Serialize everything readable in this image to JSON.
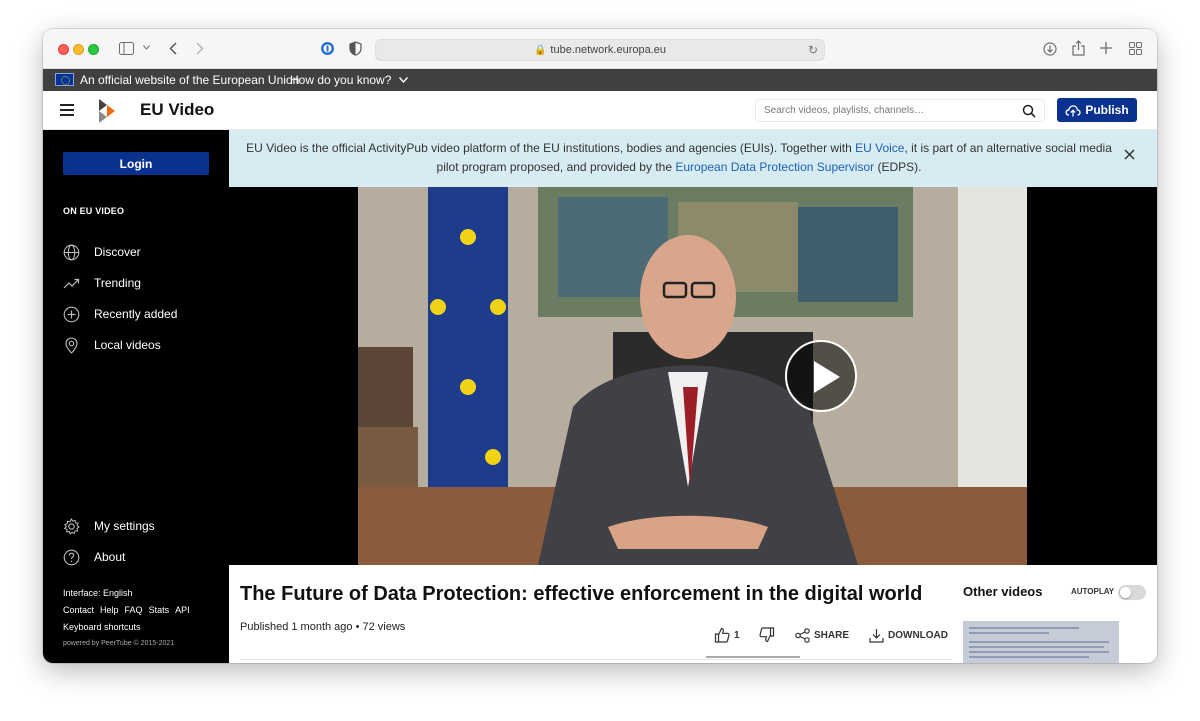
{
  "browser": {
    "url": "tube.network.europa.eu"
  },
  "eu_banner": {
    "text": "An official website of the European Union",
    "how_label": "How do you know?"
  },
  "header": {
    "site_title": "EU Video",
    "search_placeholder": "Search videos, playlists, channels…",
    "publish_label": "Publish"
  },
  "sidebar": {
    "login_label": "Login",
    "section_title": "ON EU VIDEO",
    "nav": [
      {
        "label": "Discover",
        "icon": "globe-icon"
      },
      {
        "label": "Trending",
        "icon": "trending-icon"
      },
      {
        "label": "Recently added",
        "icon": "plus-circle-icon"
      },
      {
        "label": "Local videos",
        "icon": "location-pin-icon"
      }
    ],
    "bottom_nav": [
      {
        "label": "My settings",
        "icon": "gear-icon"
      },
      {
        "label": "About",
        "icon": "help-circle-icon"
      }
    ],
    "interface_language": "Interface: English",
    "footer_links": [
      "Contact",
      "Help",
      "FAQ",
      "Stats",
      "API"
    ],
    "keyboard_shortcuts": "Keyboard shortcuts",
    "powered_by": "powered by PeerTube © 2015-2021"
  },
  "notice": {
    "part1": "EU Video is the official ActivityPub video platform of the EU institutions, bodies and agencies (EUIs). Together with ",
    "link1": "EU Voice",
    "part2": ", it is part of an alternative social media pilot program proposed, and provided by the ",
    "link2": "European Data Protection Supervisor",
    "part3": " (EDPS)."
  },
  "video": {
    "title": "The Future of Data Protection: effective enforcement in the digital world",
    "published": "Published 1 month ago",
    "views": "72 views",
    "likes": "1",
    "share_label": "SHARE",
    "download_label": "DOWNLOAD"
  },
  "other_videos": {
    "title": "Other videos",
    "autoplay_label": "AUTOPLAY",
    "autoplay_on": false
  },
  "colors": {
    "primary": "#0b318f",
    "notice_bg": "#d6ecf2",
    "link": "#1d5fb3"
  }
}
